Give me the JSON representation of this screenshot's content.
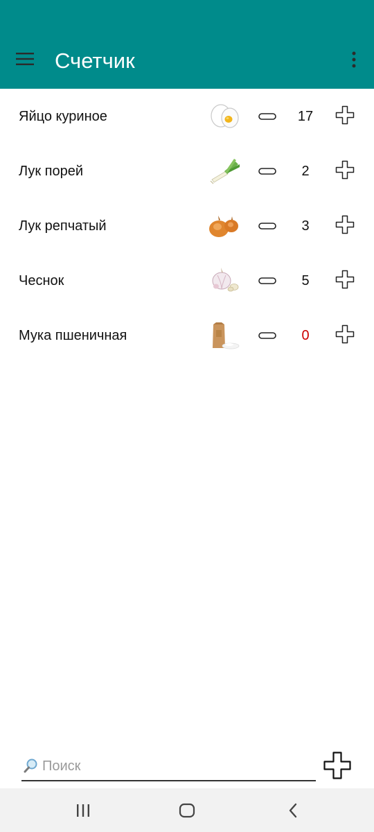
{
  "header": {
    "title": "Счетчик",
    "menu_icon": "hamburger-menu-icon",
    "overflow_icon": "more-vert-icon",
    "background": "#008b8b"
  },
  "items": [
    {
      "name": "Яйцо куриное",
      "count": "17",
      "icon": "egg-icon"
    },
    {
      "name": "Лук порей",
      "count": "2",
      "icon": "leek-icon"
    },
    {
      "name": "Лук репчатый",
      "count": "3",
      "icon": "onion-icon"
    },
    {
      "name": "Чеснок",
      "count": "5",
      "icon": "garlic-icon"
    },
    {
      "name": "Мука пшеничная",
      "count": "0",
      "icon": "flour-bag-icon"
    }
  ],
  "search": {
    "placeholder": "Поиск",
    "value": ""
  },
  "colors": {
    "zero_count": "#cc0000",
    "navbar": "#f2f2f2"
  }
}
